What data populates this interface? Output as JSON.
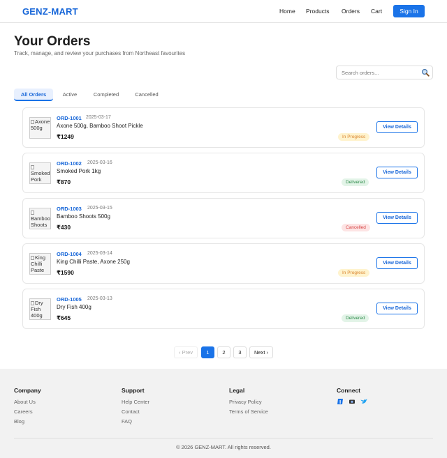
{
  "nav": {
    "brand": "GENZ-MART",
    "links": [
      "Home",
      "Products",
      "Orders",
      "Cart"
    ],
    "signin_label": "Sign In"
  },
  "header": {
    "title": "Your Orders",
    "subtitle": "Track, manage, and review your purchases from Northeast favourites"
  },
  "search": {
    "placeholder": "Search orders...",
    "value": ""
  },
  "tabs": [
    {
      "label": "All Orders",
      "active": true
    },
    {
      "label": "Active",
      "active": false
    },
    {
      "label": "Completed",
      "active": false
    },
    {
      "label": "Cancelled",
      "active": false
    }
  ],
  "orders": [
    {
      "id": "ORD-1001",
      "date": "2025-03-17",
      "items": "Axone 500g, Bamboo Shoot Pickle",
      "total": "₹1249",
      "status": "In Progress",
      "thumb_alt": "Axone 500g"
    },
    {
      "id": "ORD-1002",
      "date": "2025-03-16",
      "items": "Smoked Pork 1kg",
      "total": "₹870",
      "status": "Delivered",
      "thumb_alt": "Smoked Pork"
    },
    {
      "id": "ORD-1003",
      "date": "2025-03-15",
      "items": "Bamboo Shoots 500g",
      "total": "₹430",
      "status": "Cancelled",
      "thumb_alt": "Bamboo Shoots"
    },
    {
      "id": "ORD-1004",
      "date": "2025-03-14",
      "items": "King Chilli Paste, Axone 250g",
      "total": "₹1590",
      "status": "In Progress",
      "thumb_alt": "King Chilli Paste"
    },
    {
      "id": "ORD-1005",
      "date": "2025-03-13",
      "items": "Dry Fish 400g",
      "total": "₹645",
      "status": "Delivered",
      "thumb_alt": "Dry Fish 400g"
    }
  ],
  "view_details_label": "View Details",
  "pagination": {
    "prev": "‹ Prev",
    "pages": [
      "1",
      "2",
      "3"
    ],
    "current": "1",
    "next": "Next ›"
  },
  "footer": {
    "columns": [
      {
        "heading": "Company",
        "links": [
          "About Us",
          "Careers",
          "Blog"
        ]
      },
      {
        "heading": "Support",
        "links": [
          "Help Center",
          "Contact",
          "FAQ"
        ]
      },
      {
        "heading": "Legal",
        "links": [
          "Privacy Policy",
          "Terms of Service"
        ]
      },
      {
        "heading": "Connect",
        "icons": [
          "facebook-icon",
          "instagram-icon",
          "twitter-icon"
        ]
      }
    ],
    "copyright": "© 2026 GENZ-MART. All rights reserved."
  },
  "colors": {
    "brand": "#1565d8",
    "primary": "#1a73e8",
    "in_progress": "#d9822b",
    "delivered": "#2e8b4a",
    "cancelled": "#d64545"
  }
}
